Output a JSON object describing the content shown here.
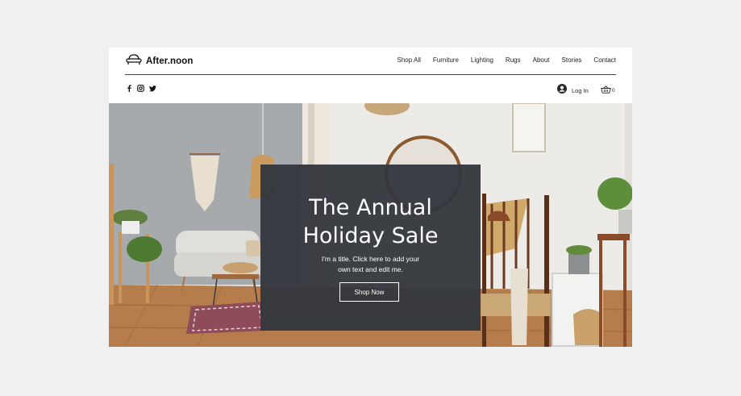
{
  "brand": {
    "name": "After.noon"
  },
  "nav": {
    "items": [
      {
        "label": "Shop All"
      },
      {
        "label": "Furniture"
      },
      {
        "label": "Lighting"
      },
      {
        "label": "Rugs"
      },
      {
        "label": "About"
      },
      {
        "label": "Stories"
      },
      {
        "label": "Contact"
      }
    ]
  },
  "social": [
    "facebook-icon",
    "instagram-icon",
    "twitter-icon"
  ],
  "account": {
    "login_label": "Log In",
    "cart_count": "0"
  },
  "hero": {
    "title_line1": "The Annual",
    "title_line2": "Holiday Sale",
    "subtitle_line1": "I'm a title. Click here to add your",
    "subtitle_line2": "own text and edit me.",
    "button_label": "Shop Now"
  },
  "colors": {
    "overlay": "#34373d",
    "page_bg": "#f0f0f0",
    "wall": "#a8abae",
    "floor": "#b07b48"
  }
}
